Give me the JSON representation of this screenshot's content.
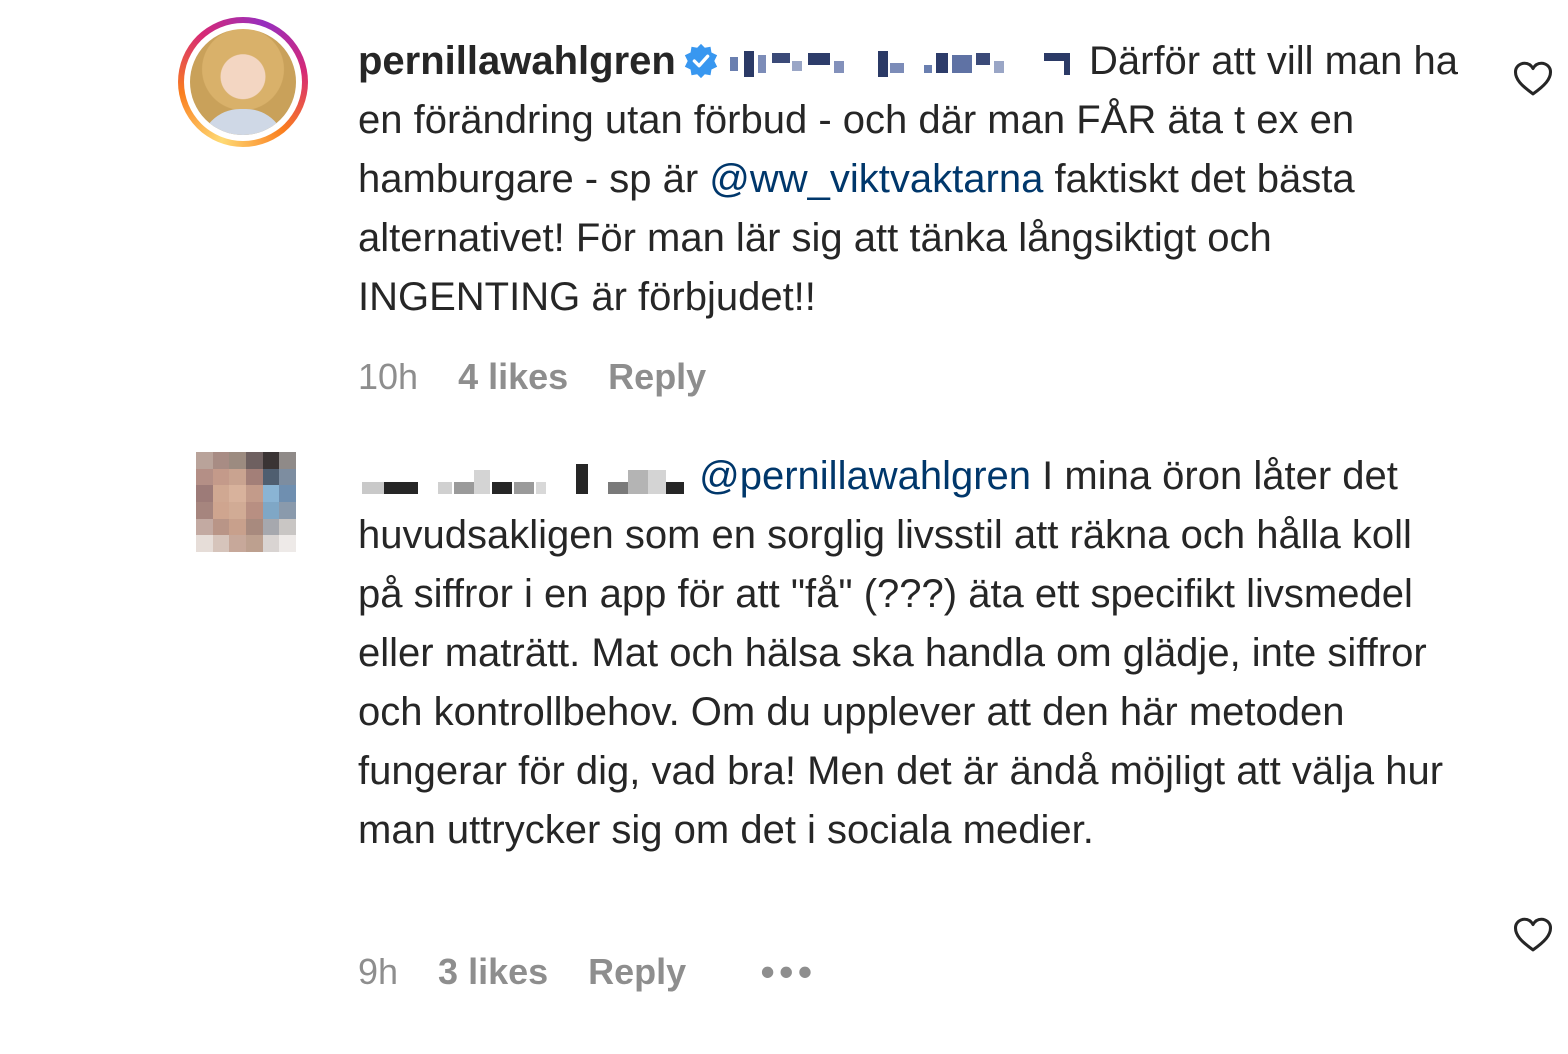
{
  "comments": [
    {
      "username": "pernillawahlgren",
      "verified": true,
      "text": "Därför att vill man ha en förändring utan förbud - och där man FÅR äta t ex en hamburgare - sp är ",
      "mention": "@ww_viktvaktarna",
      "text_after": " faktiskt det bästa alternativet! För man lär sig att tänka långsiktigt och INGENTING är förbjudet!!",
      "time": "10h",
      "likes": "4 likes",
      "reply_label": "Reply",
      "icons": {
        "avatar": "story-ring-avatar",
        "like": "heart-icon",
        "badge": "verified-badge-icon"
      }
    },
    {
      "username_obscured": true,
      "mention": "@pernillawahlgren",
      "text": " I mina öron låter det huvudsakligen som en sorglig livsstil att räkna och hålla koll på siffror i en app för att \"få\" (???) äta ett specifikt livsmedel eller maträtt. Mat och hälsa ska handla om glädje, inte siffror och kontrollbehov. Om du upplever att den här metoden fungerar för dig, vad bra! Men det är ändå möjligt att välja hur man uttrycker sig om det i sociala medier.",
      "time": "9h",
      "likes": "3 likes",
      "reply_label": "Reply",
      "more_label": "•••",
      "icons": {
        "avatar": "pixelated-avatar",
        "like": "heart-icon",
        "more": "more-options-icon"
      }
    }
  ],
  "colors": {
    "text": "#262626",
    "muted": "#8e8e8e",
    "mention": "#00376b",
    "verified": "#3897f0"
  }
}
